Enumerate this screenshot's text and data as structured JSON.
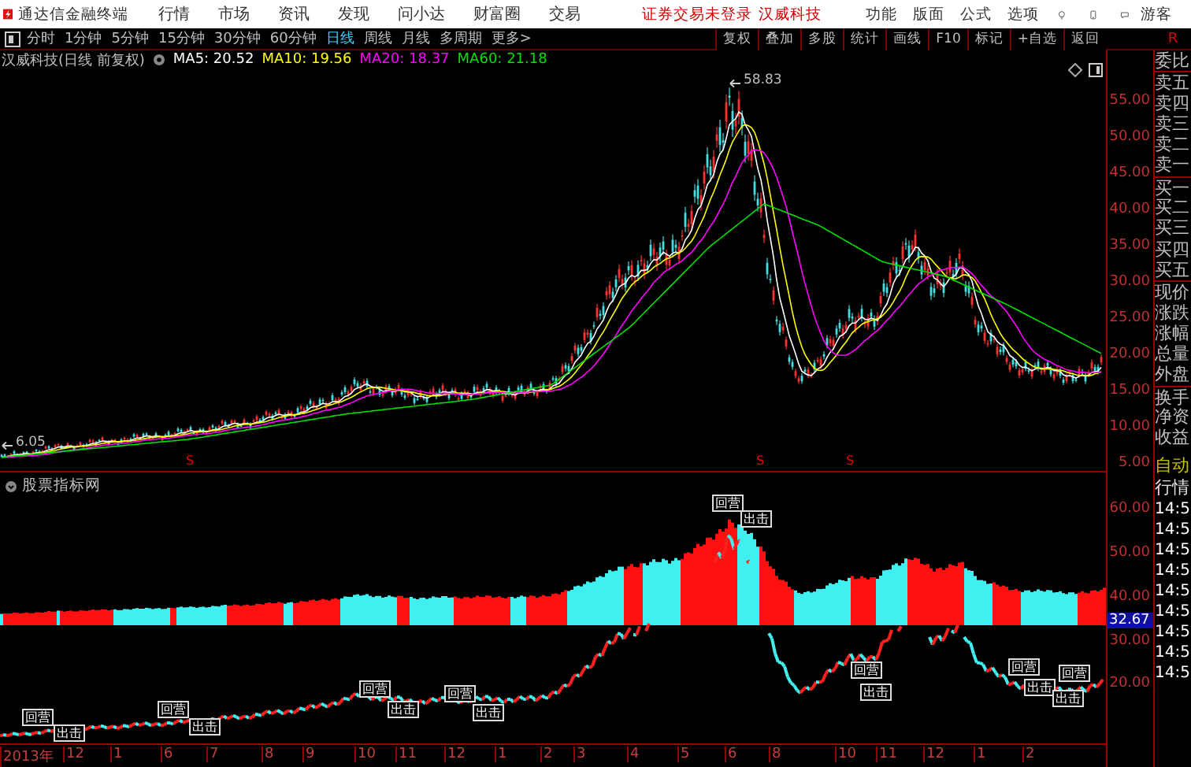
{
  "title_bar": {
    "app_name": "通达信金融终端",
    "menus": [
      "行情",
      "市场",
      "资讯",
      "发现",
      "问小达",
      "财富圈",
      "交易"
    ],
    "status": [
      "证券交易未登录",
      "汉威科技"
    ],
    "right_menus": [
      "功能",
      "版面",
      "公式",
      "选项"
    ],
    "user": "游客"
  },
  "period_tabs": [
    {
      "label": "分时",
      "selected": false
    },
    {
      "label": "1分钟",
      "selected": false
    },
    {
      "label": "5分钟",
      "selected": false
    },
    {
      "label": "15分钟",
      "selected": false
    },
    {
      "label": "30分钟",
      "selected": false
    },
    {
      "label": "60分钟",
      "selected": false
    },
    {
      "label": "日线",
      "selected": true
    },
    {
      "label": "周线",
      "selected": false
    },
    {
      "label": "月线",
      "selected": false
    },
    {
      "label": "多周期",
      "selected": false
    },
    {
      "label": "更多>",
      "selected": false
    }
  ],
  "tool_buttons": [
    "复权",
    "叠加",
    "多股",
    "统计",
    "画线",
    "F10",
    "标记",
    "+自选",
    "返回"
  ],
  "side_header": "R",
  "legend": {
    "title": "汉威科技(日线 前复权)",
    "averages": [
      {
        "label": "MA5: 20.52",
        "color": "#ffffff"
      },
      {
        "label": "MA10: 19.56",
        "color": "#ffff00"
      },
      {
        "label": "MA20: 18.37",
        "color": "#ff00ff"
      },
      {
        "label": "MA60: 21.18",
        "color": "#00e000"
      }
    ]
  },
  "price_chart": {
    "axis": [
      "55.00",
      "50.00",
      "45.00",
      "40.00",
      "35.00",
      "30.00",
      "25.00",
      "20.00",
      "15.00",
      "10.00",
      "5.00"
    ],
    "high_label": "58.83",
    "low_label": "6.05",
    "markers": [
      "S",
      "S",
      "S"
    ]
  },
  "indicator": {
    "title": "股票指标网",
    "axis": [
      {
        "label": "60.00",
        "current": false
      },
      {
        "label": "50.00",
        "current": false
      },
      {
        "label": "40.00",
        "current": false
      },
      {
        "label": "32.67",
        "current": true
      },
      {
        "label": "30.00",
        "current": false
      },
      {
        "label": "20.00",
        "current": false
      }
    ],
    "signals": [
      "回营",
      "出击",
      "回营",
      "出击",
      "回营",
      "出击",
      "回营",
      "出击",
      "回营",
      "出击",
      "回营",
      "出击",
      "回营",
      "出击",
      "回营",
      "出击"
    ]
  },
  "time_axis": [
    "2013年",
    "12",
    "1",
    "6",
    "7",
    "8",
    "9",
    "10",
    "11",
    "12",
    "1",
    "2",
    "3",
    "4",
    "5",
    "6",
    "8",
    "10",
    "11",
    "12",
    "1",
    "2"
  ],
  "quote_panel": {
    "fields": [
      "委比",
      "卖五",
      "卖四",
      "卖三",
      "卖二",
      "卖一",
      "买一",
      "买二",
      "买三",
      "买四",
      "买五",
      "现价",
      "涨跌",
      "涨幅",
      "总量",
      "外盘",
      "换手",
      "净资",
      "收益"
    ],
    "mode": "自动",
    "section": "行情",
    "ticks": [
      "14:5",
      "14:5",
      "14:5",
      "14:5",
      "14:5",
      "14:5",
      "14:5",
      "14:5",
      "14:5"
    ]
  }
}
